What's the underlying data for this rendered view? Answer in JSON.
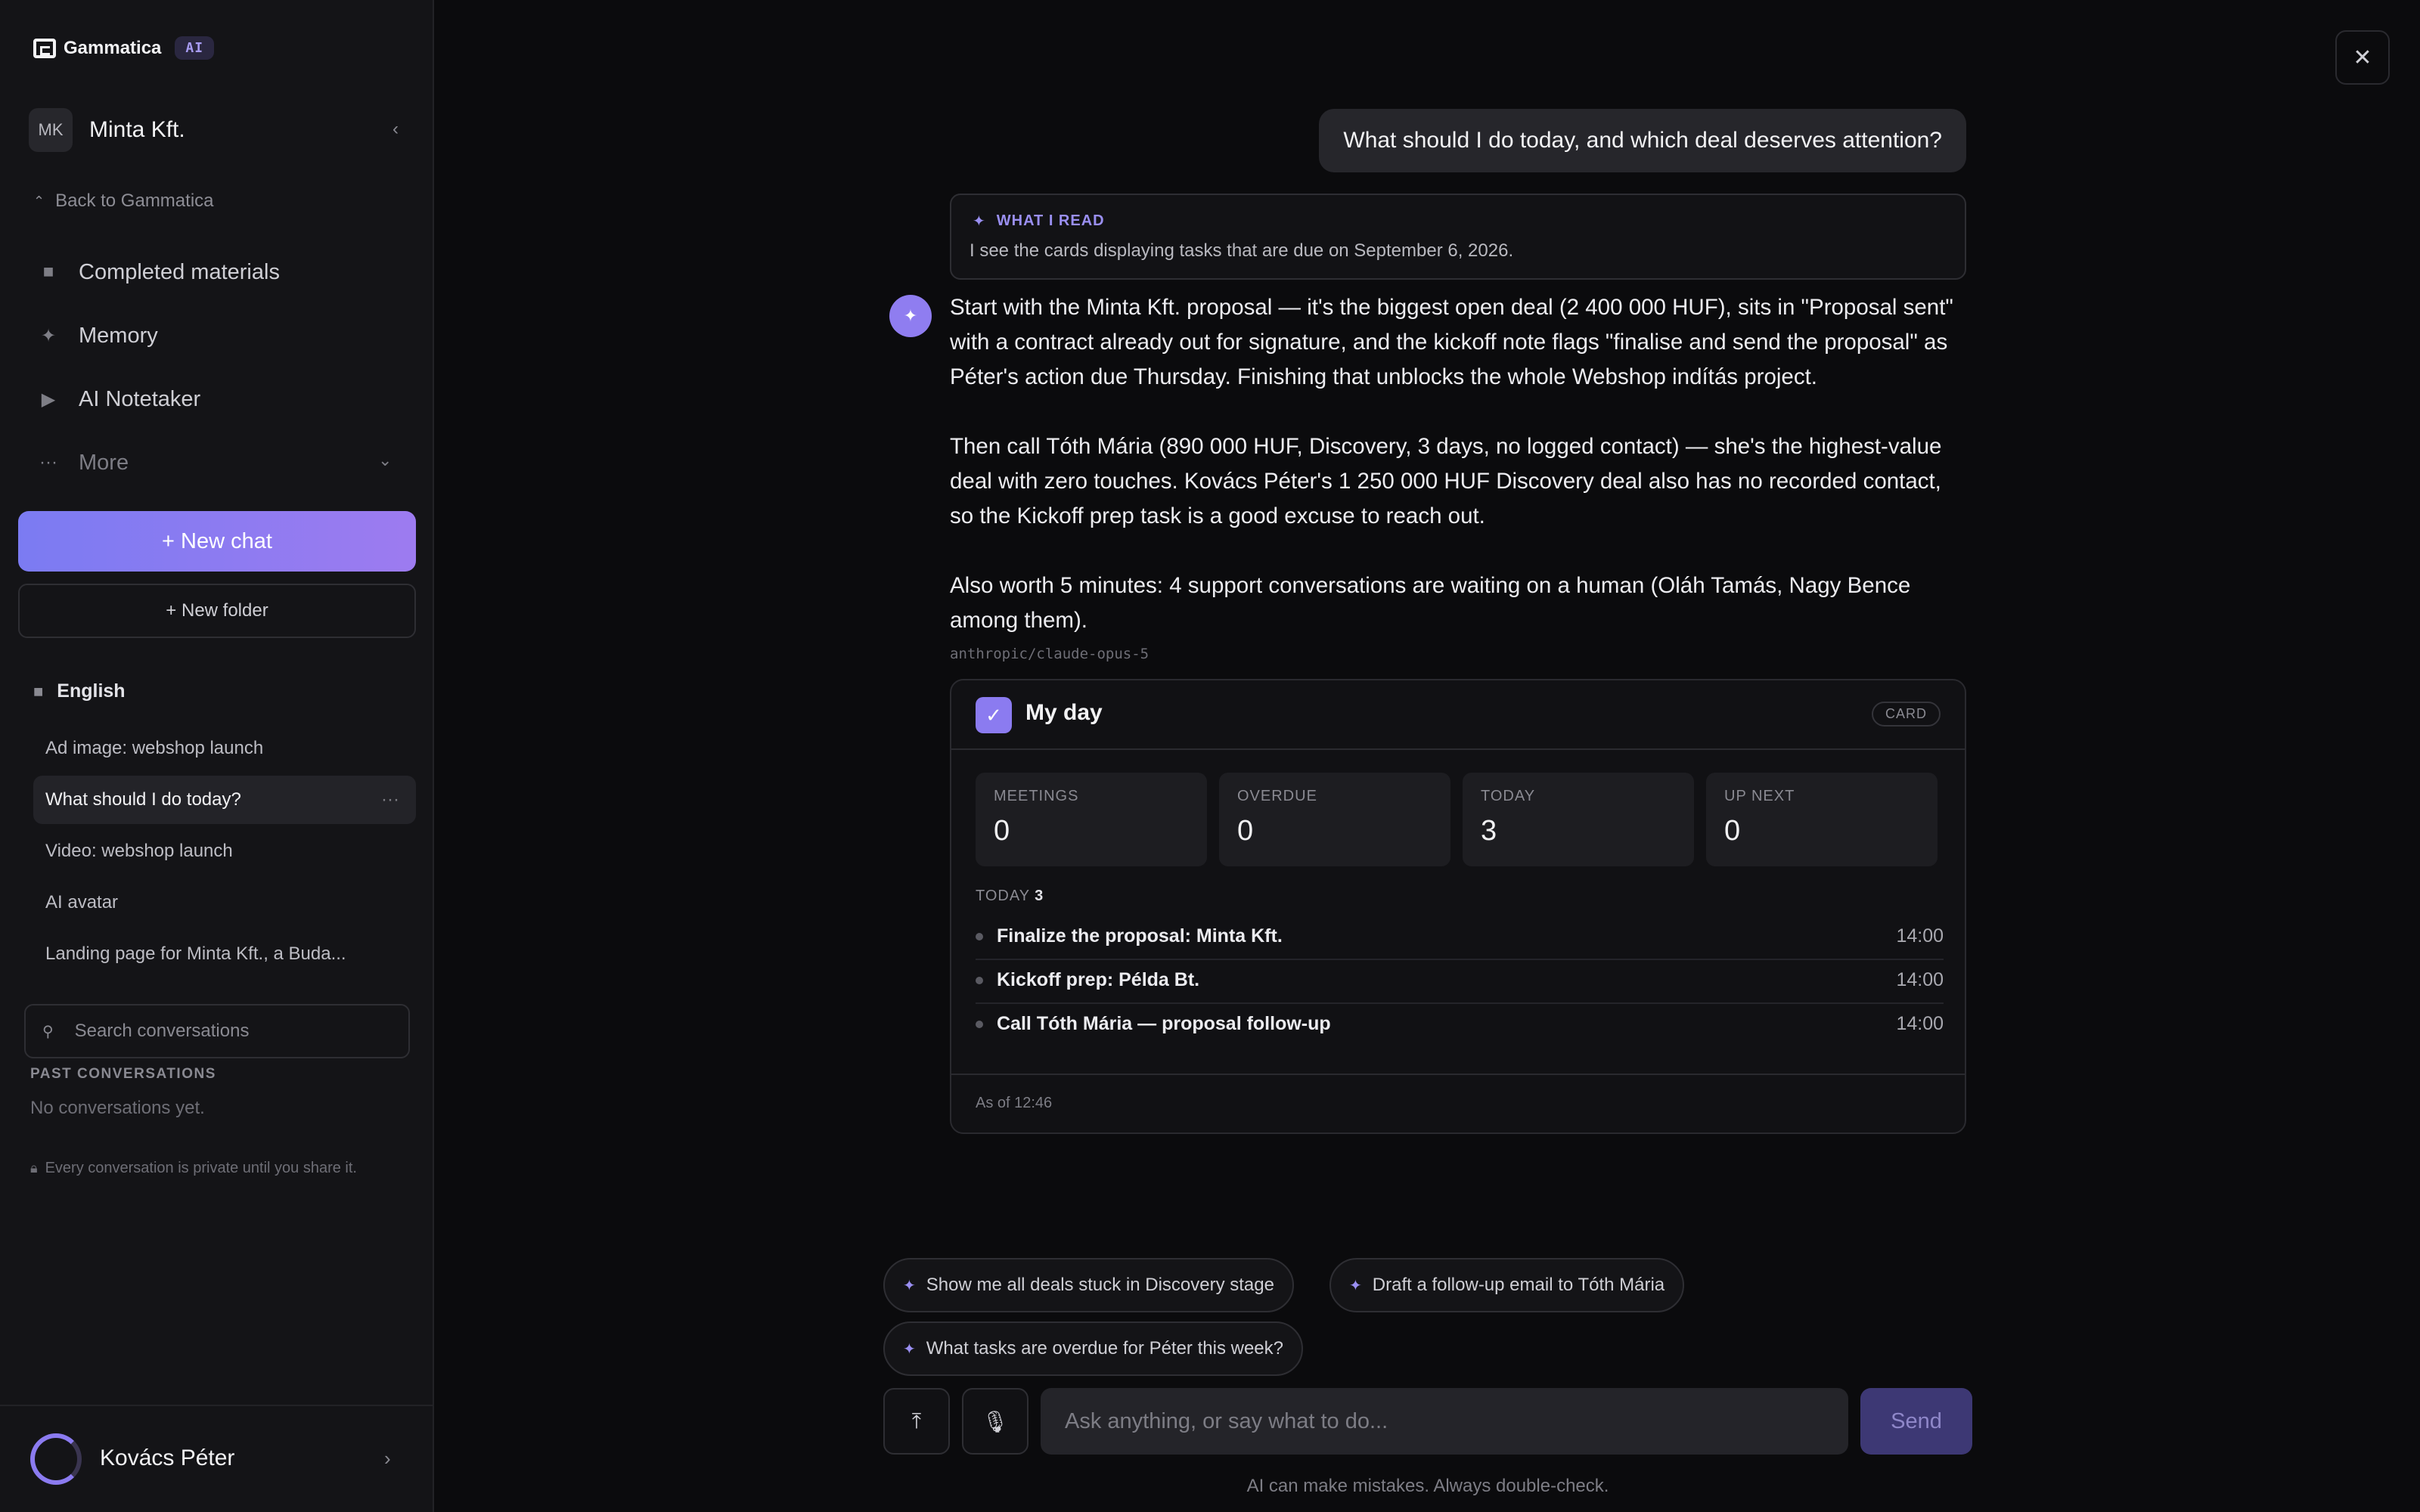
{
  "brand": {
    "name": "Gammatica",
    "badge": "AI"
  },
  "workspace": {
    "initials": "MK",
    "name": "Minta Kft."
  },
  "sidebar": {
    "back_link": "Back to Gammatica",
    "nav": [
      {
        "label": "Completed materials",
        "icon": "folder-icon"
      },
      {
        "label": "Memory",
        "icon": "sparkle-icon"
      },
      {
        "label": "AI Notetaker",
        "icon": "video-camera-icon"
      },
      {
        "label": "More",
        "icon": "ellipsis-icon"
      }
    ],
    "new_chat": "+ New chat",
    "new_folder": "+ New folder",
    "folder": {
      "name": "English"
    },
    "conversations": [
      "Ad image: webshop launch",
      "What should I do today?",
      "Video: webshop launch",
      "AI avatar",
      "Landing page for Minta Kft., a Buda..."
    ],
    "active_conversation_index": 1,
    "search_placeholder": "Search conversations",
    "past_label": "PAST CONVERSATIONS",
    "past_empty": "No conversations yet.",
    "privacy_note": "Every conversation is private until you share it."
  },
  "user": {
    "name": "Kovács Péter"
  },
  "chat": {
    "user_message": "What should I do today, and which deal deserves attention?",
    "read": {
      "label": "WHAT I READ",
      "text": "I see the cards displaying tasks that are due on September 6, 2026."
    },
    "answer": [
      "Start with the Minta Kft. proposal — it's the biggest open deal (2 400 000 HUF), sits in \"Proposal sent\" with a contract already out for signature, and the kickoff note flags \"finalise and send the proposal\" as Péter's action due Thursday. Finishing that unblocks the whole Webshop indítás project.",
      "Then call Tóth Mária (890 000 HUF, Discovery, 3 days, no logged contact) — she's the highest-value deal with zero touches. Kovács Péter's 1 250 000 HUF Discovery deal also has no recorded contact, so the Kickoff prep task is a good excuse to reach out.",
      "Also worth 5 minutes: 4 support conversations are waiting on a human (Oláh Tamás, Nagy Bence among them)."
    ],
    "model": "anthropic/claude-opus-5"
  },
  "card": {
    "title": "My day",
    "badge": "CARD",
    "stats": [
      {
        "label": "MEETINGS",
        "value": "0"
      },
      {
        "label": "OVERDUE",
        "value": "0"
      },
      {
        "label": "TODAY",
        "value": "3"
      },
      {
        "label": "UP NEXT",
        "value": "0"
      }
    ],
    "today_label": "TODAY",
    "today_count": "3",
    "tasks": [
      {
        "name": "Finalize the proposal: Minta Kft.",
        "time": "14:00"
      },
      {
        "name": "Kickoff prep: Példa Bt.",
        "time": "14:00"
      },
      {
        "name": "Call Tóth Mária — proposal follow-up",
        "time": "14:00"
      }
    ],
    "footer": "As of 12:46"
  },
  "suggestions": [
    "Show me all deals stuck in Discovery stage",
    "Draft a follow-up email to Tóth Mária",
    "What tasks are overdue for Péter this week?"
  ],
  "composer": {
    "placeholder": "Ask anything, or say what to do...",
    "send": "Send",
    "disclaimer": "AI can make mistakes. Always double-check."
  },
  "colors": {
    "accent": "#8b7bf0",
    "background": "#0b0b0d",
    "sidebar": "#141417"
  }
}
